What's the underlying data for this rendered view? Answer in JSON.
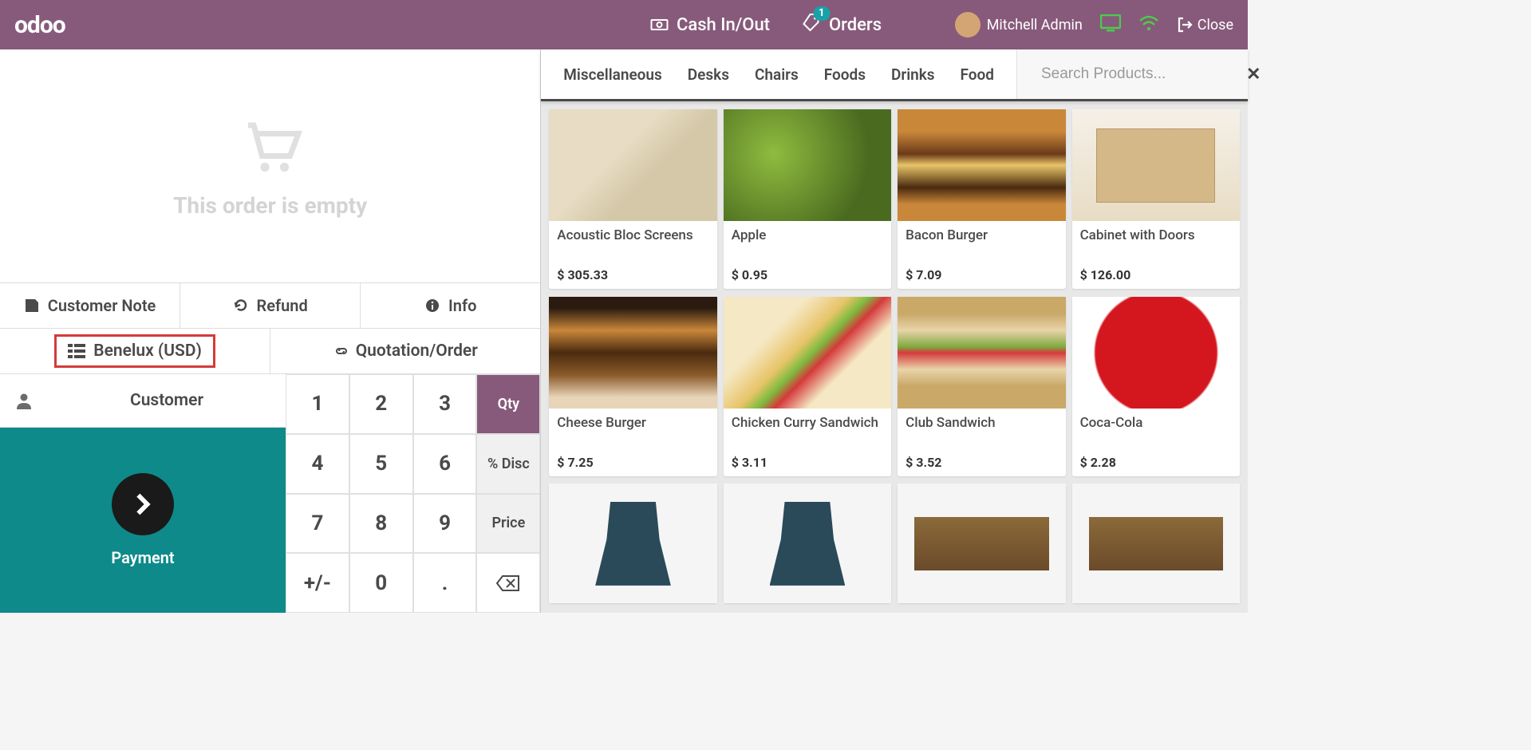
{
  "header": {
    "logo": "odoo",
    "cash_label": "Cash In/Out",
    "orders_label": "Orders",
    "orders_badge": "1",
    "user_name": "Mitchell Admin",
    "close_label": "Close"
  },
  "order": {
    "empty_text": "This order is empty"
  },
  "actions": {
    "customer_note": "Customer Note",
    "refund": "Refund",
    "info": "Info",
    "pricelist": "Benelux (USD)",
    "quotation": "Quotation/Order",
    "customer": "Customer",
    "payment": "Payment"
  },
  "numpad": {
    "keys": [
      "1",
      "2",
      "3",
      "4",
      "5",
      "6",
      "7",
      "8",
      "9",
      "+/-",
      "0",
      "."
    ],
    "modes": {
      "qty": "Qty",
      "disc": "% Disc",
      "price": "Price"
    },
    "backspace": "⌫"
  },
  "categories": [
    "Miscellaneous",
    "Desks",
    "Chairs",
    "Foods",
    "Drinks",
    "Food"
  ],
  "search": {
    "placeholder": "Search Products..."
  },
  "products": [
    {
      "name": "Acoustic Bloc Screens",
      "price": "$ 305.33",
      "thumb": "thumb-screens"
    },
    {
      "name": "Apple",
      "price": "$ 0.95",
      "thumb": "thumb-apple"
    },
    {
      "name": "Bacon Burger",
      "price": "$ 7.09",
      "thumb": "thumb-bacon"
    },
    {
      "name": "Cabinet with Doors",
      "price": "$ 126.00",
      "thumb": "thumb-cabinet"
    },
    {
      "name": "Cheese Burger",
      "price": "$ 7.25",
      "thumb": "thumb-cheese"
    },
    {
      "name": "Chicken Curry Sandwich",
      "price": "$ 3.11",
      "thumb": "thumb-sandwich"
    },
    {
      "name": "Club Sandwich",
      "price": "$ 3.52",
      "thumb": "thumb-club"
    },
    {
      "name": "Coca-Cola",
      "price": "$ 2.28",
      "thumb": "thumb-cola"
    }
  ],
  "products_partial": [
    {
      "thumb": "thumb-chair"
    },
    {
      "thumb": "thumb-chair"
    },
    {
      "thumb": "thumb-desk"
    },
    {
      "thumb": "thumb-desk"
    }
  ]
}
